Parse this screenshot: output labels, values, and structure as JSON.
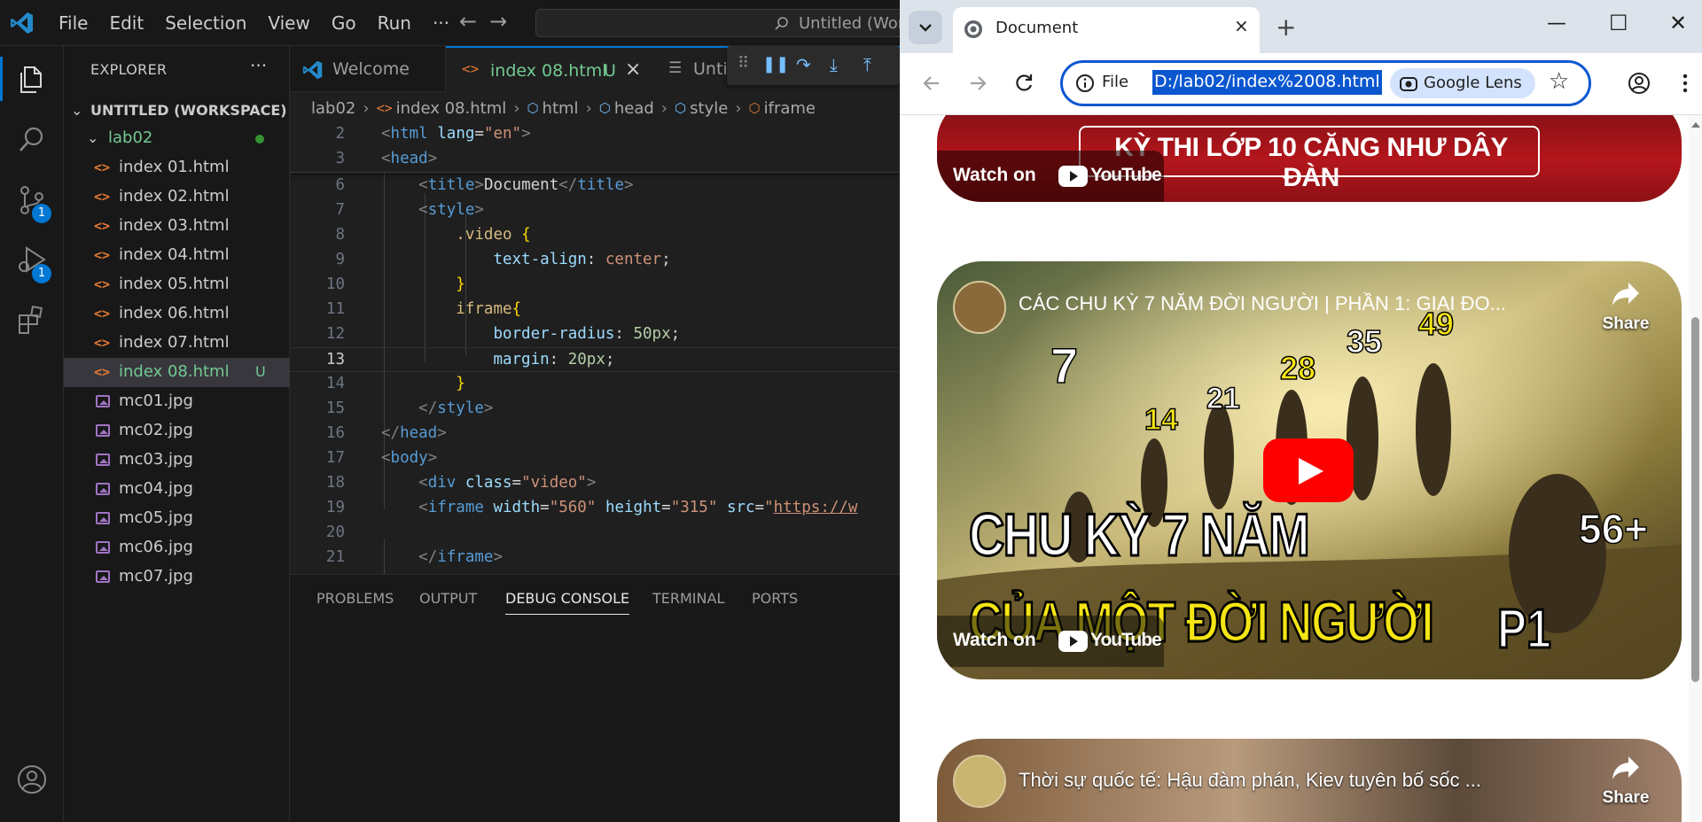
{
  "vscode": {
    "menu": [
      "File",
      "Edit",
      "Selection",
      "View",
      "Go",
      "Run",
      "···"
    ],
    "command_center": "Untitled (Workspace)",
    "activity_badges": {
      "source_control": "1",
      "run_debug": "1"
    },
    "explorer": {
      "title": "EXPLORER",
      "more": "···",
      "workspace": "UNTITLED (WORKSPACE)",
      "folder": "lab02",
      "files": [
        {
          "name": "index 01.html",
          "icon": "<>"
        },
        {
          "name": "index 02.html",
          "icon": "<>"
        },
        {
          "name": "index 03.html",
          "icon": "<>"
        },
        {
          "name": "index 04.html",
          "icon": "<>"
        },
        {
          "name": "index 05.html",
          "icon": "<>"
        },
        {
          "name": "index 06.html",
          "icon": "<>"
        },
        {
          "name": "index 07.html",
          "icon": "<>"
        },
        {
          "name": "index 08.html",
          "icon": "<>",
          "status": "U"
        },
        {
          "name": "mc01.jpg"
        },
        {
          "name": "mc02.jpg"
        },
        {
          "name": "mc03.jpg"
        },
        {
          "name": "mc04.jpg"
        },
        {
          "name": "mc05.jpg"
        },
        {
          "name": "mc06.jpg"
        },
        {
          "name": "mc07.jpg"
        }
      ]
    },
    "tabs": [
      {
        "label": "Welcome"
      },
      {
        "label": "index 08.html",
        "status": "U",
        "close": "×"
      },
      {
        "label": "Unti"
      }
    ],
    "breadcrumb": [
      "lab02",
      "index 08.html",
      "html",
      "head",
      "style",
      "iframe"
    ],
    "code": {
      "line_numbers": [
        "2",
        "3",
        "6",
        "7",
        "8",
        "9",
        "10",
        "11",
        "12",
        "13",
        "14",
        "15",
        "16",
        "17",
        "18",
        "19",
        "20",
        "21"
      ],
      "html_open": "<html lang=\"en\">",
      "current_line": "13"
    },
    "panel_tabs": [
      "PROBLEMS",
      "OUTPUT",
      "DEBUG CONSOLE",
      "TERMINAL",
      "PORTS"
    ]
  },
  "chrome": {
    "tab_title": "Document",
    "tab_close": "×",
    "new_tab": "+",
    "url_scheme": "File",
    "url": "D:/lab02/index%2008.html",
    "lens_label": "Google Lens",
    "videos": [
      {
        "banner": "KỲ THI LỚP 10 CĂNG NHƯ DÂY ĐÀN",
        "watch_on": "Watch on",
        "youtube": "YouTube"
      },
      {
        "title": "CÁC CHU KỲ 7 NĂM ĐỜI NGƯỜI | PHẦN 1: GIAI ĐO...",
        "share": "Share",
        "watch_on": "Watch on",
        "youtube": "YouTube",
        "thumb_line1": "CHU KỲ 7 NĂM",
        "thumb_line2": "CỦA MỘT ĐỜI NGƯỜI",
        "thumb_part": "P1",
        "ages": [
          "7",
          "14",
          "21",
          "28",
          "35",
          "49",
          "56+"
        ]
      },
      {
        "title": "Thời sự quốc tế: Hậu đàm phán, Kiev tuyên bố sốc ...",
        "share": "Share"
      }
    ]
  }
}
